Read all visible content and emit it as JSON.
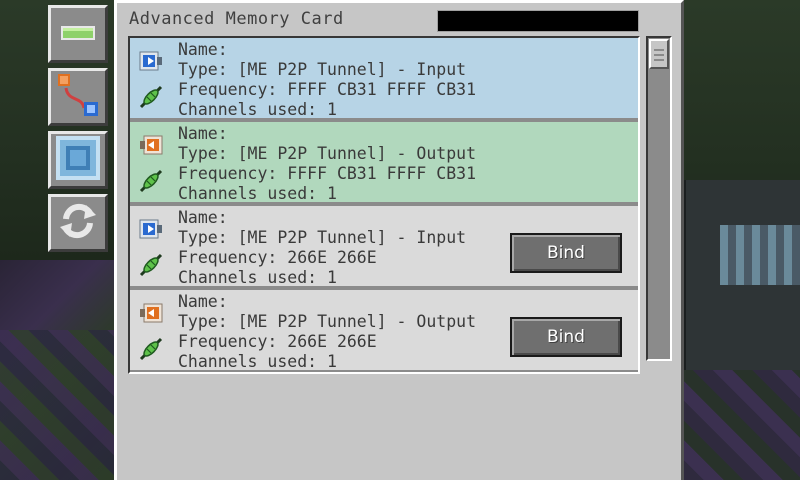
{
  "window": {
    "title": "Advanced Memory Card",
    "name_field_value": ""
  },
  "toolbar": [
    {
      "name": "clear-button",
      "icon": "bar-icon"
    },
    {
      "name": "link-mode-button",
      "icon": "p2p-link-icon"
    },
    {
      "name": "glass-block-button",
      "icon": "glass-block-icon"
    },
    {
      "name": "refresh-button",
      "icon": "refresh-arrows-icon"
    }
  ],
  "entries": [
    {
      "name_line": "Name:",
      "type_line": "Type: [ME P2P Tunnel] - Input",
      "frequency_line": "Frequency: FFFF CB31 FFFF CB31",
      "channels_line": "Channels used: 1",
      "kind": "input",
      "highlight": "#b7d4e6",
      "bind_label": ""
    },
    {
      "name_line": "Name:",
      "type_line": "Type: [ME P2P Tunnel] - Output",
      "frequency_line": "Frequency: FFFF CB31 FFFF CB31",
      "channels_line": "Channels used: 1",
      "kind": "output",
      "highlight": "#b1d8bd",
      "bind_label": ""
    },
    {
      "name_line": "Name:",
      "type_line": "Type: [ME P2P Tunnel] - Input",
      "frequency_line": "Frequency: 266E 266E",
      "channels_line": "Channels used: 1",
      "kind": "input",
      "highlight": "#dadada",
      "bind_label": "Bind"
    },
    {
      "name_line": "Name:",
      "type_line": "Type: [ME P2P Tunnel] - Output",
      "frequency_line": "Frequency: 266E 266E",
      "channels_line": "Channels used: 1",
      "kind": "output",
      "highlight": "#dadada",
      "bind_label": "Bind"
    }
  ]
}
